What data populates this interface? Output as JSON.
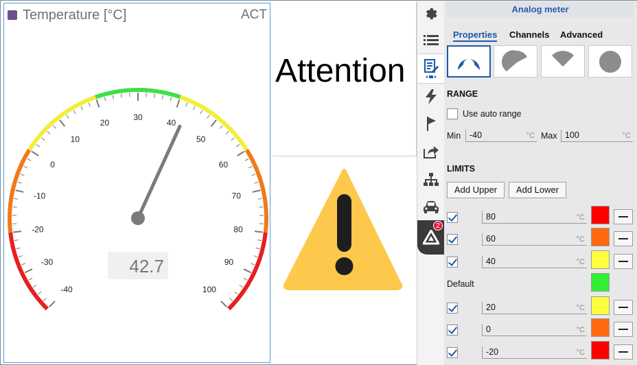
{
  "gauge": {
    "title": "Temperature [°C]",
    "title_color": "#6b4f8f",
    "status": "ACT",
    "value": 42.7,
    "value_label": "42.7",
    "min": -40,
    "max": 100,
    "tick_labels": [
      "-40",
      "-30",
      "-20",
      "-10",
      "0",
      "10",
      "20",
      "30",
      "40",
      "50",
      "60",
      "70",
      "80",
      "90",
      "100"
    ],
    "zones": [
      {
        "from": -40,
        "to": -20,
        "color": "#e52020"
      },
      {
        "from": -20,
        "to": 0,
        "color": "#f07a1a"
      },
      {
        "from": 0,
        "to": 20,
        "color": "#f2ee3a"
      },
      {
        "from": 20,
        "to": 40,
        "color": "#3fe048"
      },
      {
        "from": 40,
        "to": 60,
        "color": "#f2ee3a"
      },
      {
        "from": 60,
        "to": 80,
        "color": "#f07a1a"
      },
      {
        "from": 80,
        "to": 100,
        "color": "#e52020"
      }
    ]
  },
  "attention": {
    "text": "Attention",
    "icon": "warning-triangle-icon",
    "icon_color": "#fdc84b"
  },
  "iconbar": {
    "items": [
      "gear-icon",
      "list-icon",
      "edit-properties-icon",
      "lightning-icon",
      "flag-icon",
      "share-icon",
      "hierarchy-icon",
      "car-icon",
      "alert-brand-icon"
    ],
    "badge": "2"
  },
  "props": {
    "title": "Analog meter",
    "tabs": [
      "Properties",
      "Channels",
      "Advanced"
    ],
    "shapes": [
      "gauge-arc-icon",
      "pie-sector-icon",
      "fan-sector-icon",
      "full-circle-icon"
    ],
    "range": {
      "heading": "RANGE",
      "auto_label": "Use auto range",
      "min_label": "Min",
      "min_value": "-40",
      "max_label": "Max",
      "max_value": "100",
      "unit": "°C"
    },
    "limits": {
      "heading": "LIMITS",
      "add_upper": "Add Upper",
      "add_lower": "Add Lower",
      "default_label": "Default",
      "default_color": "#33ee33",
      "upper": [
        {
          "value": "80",
          "color": "#ff0000"
        },
        {
          "value": "60",
          "color": "#ff6a10"
        },
        {
          "value": "40",
          "color": "#ffff40"
        }
      ],
      "lower": [
        {
          "value": "20",
          "color": "#ffff40"
        },
        {
          "value": "0",
          "color": "#ff6a10"
        },
        {
          "value": "-20",
          "color": "#ff0000"
        }
      ],
      "unit": "°C"
    }
  }
}
